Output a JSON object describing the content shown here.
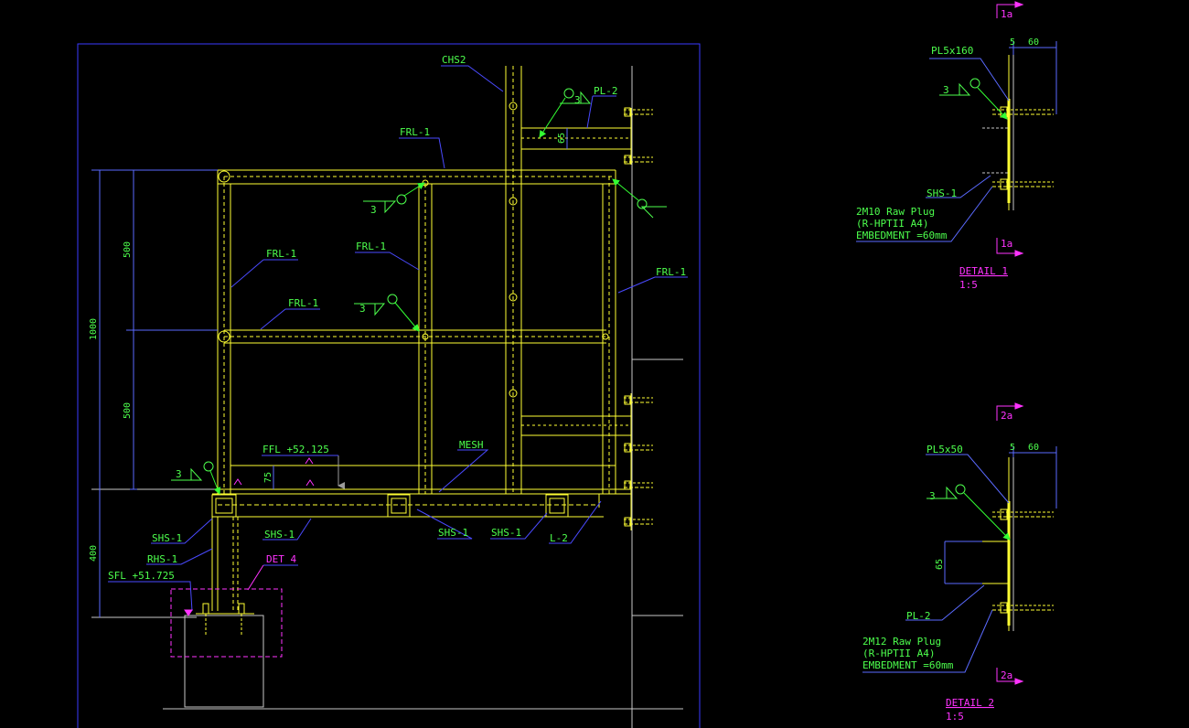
{
  "colors": {
    "background": "#000000",
    "border": "#3a3aff",
    "steel": "#ffff33",
    "label_text": "#4dff4d",
    "leader": "#4a4aff",
    "weld_arrow": "#33ff33",
    "detail_marker": "#ff33ff",
    "dim_line": "#5a6aff",
    "grey_line": "#c8c8c8"
  },
  "main_view": {
    "chs_label": "CHS2",
    "pl2_label": "PL-2",
    "frl_labels": [
      "FRL-1",
      "FRL-1",
      "FRL-1",
      "FRL-1",
      "FRL-1"
    ],
    "weld_size": "3",
    "dim_65": "65",
    "dim_500_top": "500",
    "dim_500_bottom": "500",
    "dim_1000": "1000",
    "dim_400": "400",
    "dim_75": "75",
    "ffl_label": "FFL +52.125",
    "mesh_label": "MESH",
    "shs_labels": [
      "SHS-1",
      "SHS-1",
      "SHS-1",
      "SHS-1"
    ],
    "rhs_label": "RHS-1",
    "l2_label": "L-2",
    "sfl_label": "SFL +51.725",
    "det4_label": "DET 4"
  },
  "detail_1": {
    "section_marker": "1a",
    "plate_label": "PL5x160",
    "dim_5": "5",
    "dim_60": "60",
    "weld_size": "3",
    "shs_label": "SHS-1",
    "anchor_line1": "2M10 Raw Plug",
    "anchor_line2": "(R-HPTII A4)",
    "anchor_line3": "EMBEDMENT =60mm",
    "title": "DETAIL 1",
    "scale": "1:5"
  },
  "detail_2": {
    "section_marker": "2a",
    "plate_label": "PL5x50",
    "dim_5": "5",
    "dim_60": "60",
    "weld_size": "3",
    "dim_65": "65",
    "pl_label": "PL-2",
    "anchor_line1": "2M12 Raw Plug",
    "anchor_line2": "(R-HPTII A4)",
    "anchor_line3": "EMBEDMENT =60mm",
    "title": "DETAIL 2",
    "scale": "1:5"
  }
}
